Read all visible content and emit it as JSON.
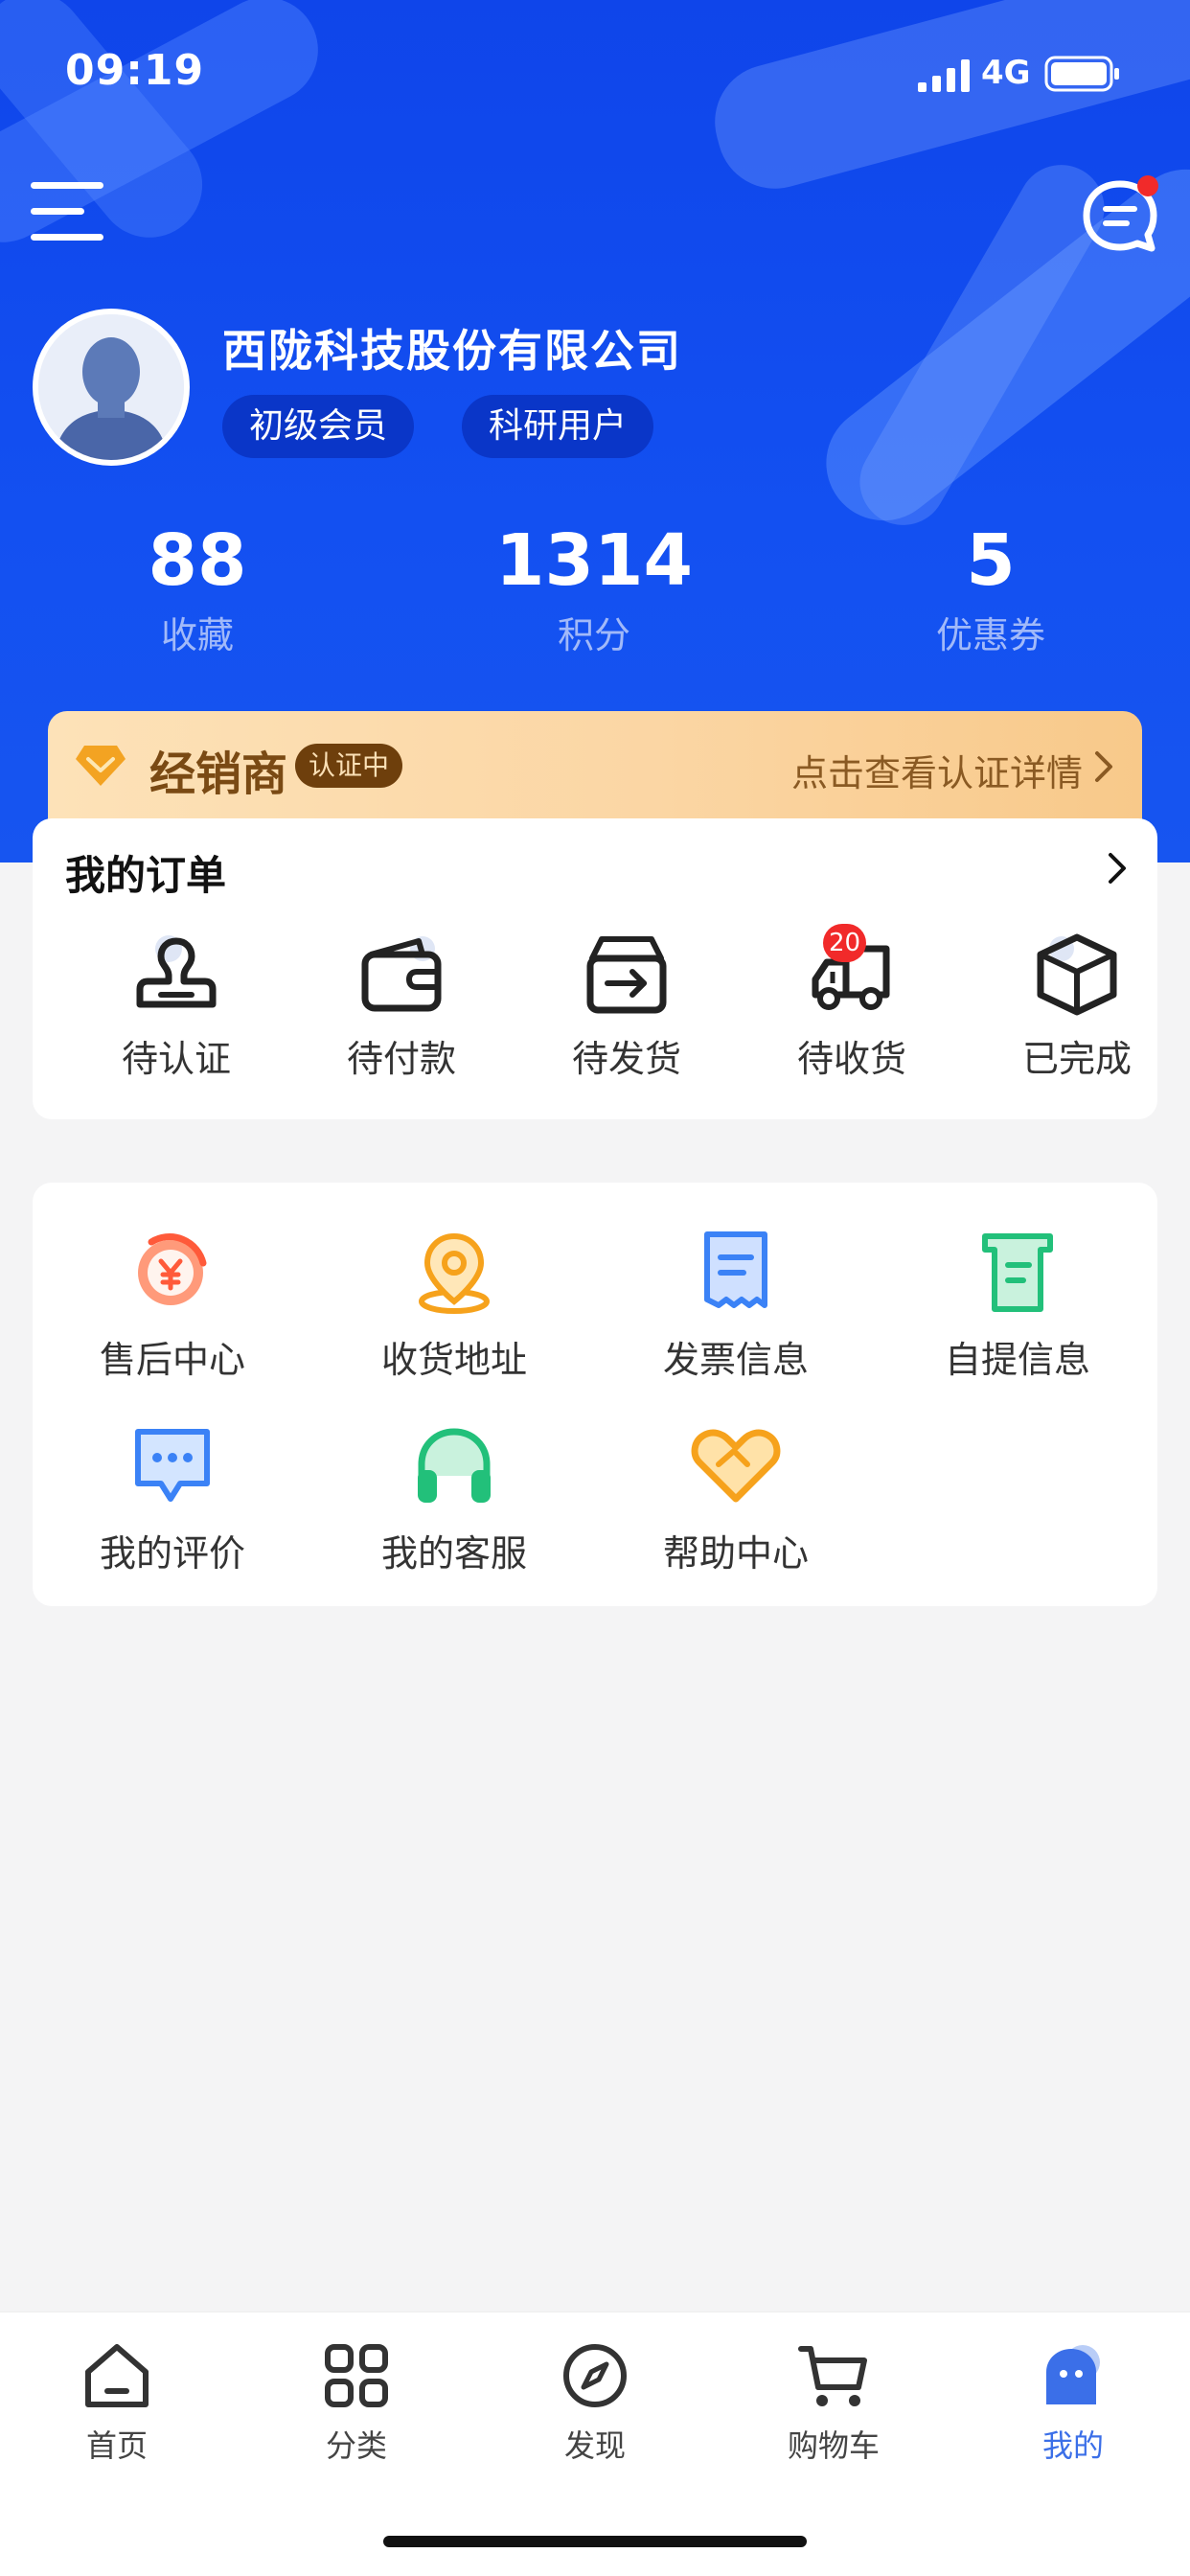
{
  "status_bar": {
    "time": "09:19",
    "network": "4G"
  },
  "user": {
    "company": "西陇科技股份有限公司",
    "tags": [
      "初级会员",
      "科研用户"
    ]
  },
  "stats": [
    {
      "value": "88",
      "label": "收藏"
    },
    {
      "value": "1314",
      "label": "积分"
    },
    {
      "value": "5",
      "label": "优惠券"
    }
  ],
  "dealer": {
    "title": "经销商",
    "badge": "认证中",
    "link": "点击查看认证详情"
  },
  "orders": {
    "title": "我的订单",
    "items": [
      {
        "label": "待认证",
        "icon": "stamp-icon"
      },
      {
        "label": "待付款",
        "icon": "wallet-icon"
      },
      {
        "label": "待发货",
        "icon": "box-out-icon"
      },
      {
        "label": "待收货",
        "icon": "truck-icon",
        "badge": "20"
      },
      {
        "label": "已完成",
        "icon": "package-icon"
      }
    ]
  },
  "services": [
    {
      "label": "售后中心",
      "icon": "refund-icon"
    },
    {
      "label": "收货地址",
      "icon": "location-icon"
    },
    {
      "label": "发票信息",
      "icon": "invoice-icon"
    },
    {
      "label": "自提信息",
      "icon": "pickup-icon"
    },
    {
      "label": "我的评价",
      "icon": "comment-icon"
    },
    {
      "label": "我的客服",
      "icon": "headset-icon"
    },
    {
      "label": "帮助中心",
      "icon": "handshake-icon"
    }
  ],
  "tabbar": [
    {
      "label": "首页",
      "icon": "home-icon"
    },
    {
      "label": "分类",
      "icon": "category-icon"
    },
    {
      "label": "发现",
      "icon": "compass-icon"
    },
    {
      "label": "购物车",
      "icon": "cart-icon"
    },
    {
      "label": "我的",
      "icon": "profile-icon",
      "active": true
    }
  ],
  "colors": {
    "primary": "#1350f1",
    "active_tab": "#3b6fe8",
    "badge_red": "#f12a2a"
  }
}
